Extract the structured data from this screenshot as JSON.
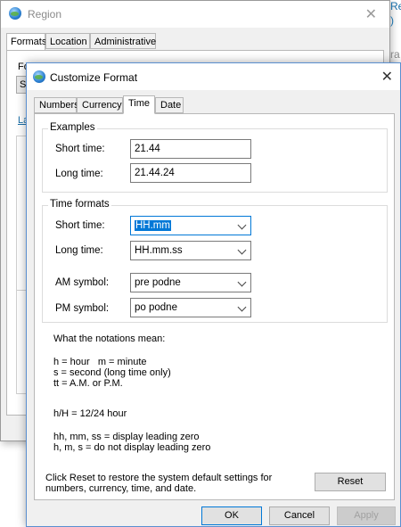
{
  "region_window": {
    "title": "Region",
    "close_glyph": "✕",
    "tabs": [
      "Formats",
      "Location",
      "Administrative"
    ],
    "stubs": [
      "Fo",
      "S",
      "La"
    ],
    "side_text": [
      "Re",
      ")",
      "ra"
    ]
  },
  "dialog": {
    "title": "Customize Format",
    "close_glyph": "✕",
    "tabs": [
      "Numbers",
      "Currency",
      "Time",
      "Date"
    ],
    "active_tab": "Time",
    "examples": {
      "legend": "Examples",
      "short_time_label": "Short time:",
      "short_time_value": "21.44",
      "long_time_label": "Long time:",
      "long_time_value": "21.44.24"
    },
    "time_formats": {
      "legend": "Time formats",
      "short_time_label": "Short time:",
      "short_time_value": "HH.mm",
      "long_time_label": "Long time:",
      "long_time_value": "HH.mm.ss",
      "am_label": "AM symbol:",
      "am_value": "pre podne",
      "pm_label": "PM symbol:",
      "pm_value": "po podne"
    },
    "notations": {
      "heading": "What the notations mean:",
      "block1": "h = hour   m = minute\ns = second (long time only)\ntt = A.M. or P.M.",
      "block2": "h/H = 12/24 hour",
      "block3": "hh, mm, ss = display leading zero\nh, m, s = do not display leading zero"
    },
    "reset_text": "Click Reset to restore the system default settings for\nnumbers, currency, time, and date.",
    "reset_button": "Reset",
    "ok_button": "OK",
    "cancel_button": "Cancel",
    "apply_button": "Apply"
  }
}
